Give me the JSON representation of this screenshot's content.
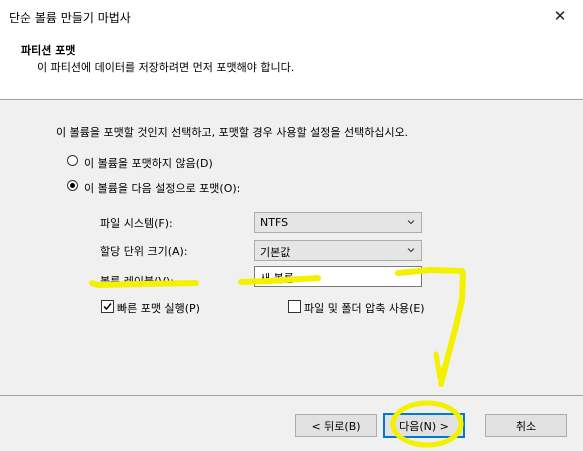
{
  "window": {
    "title": "단순 볼륨 만들기 마법사",
    "close_glyph": "✕"
  },
  "header": {
    "title": "파티션 포맷",
    "subtitle": "이 파티션에 데이터를 저장하려면 먼저 포맷해야 합니다."
  },
  "main": {
    "question": "이 볼륨을 포맷할 것인지 선택하고, 포맷할 경우 사용할 설정을 선택하십시오.",
    "radio_no_format": {
      "label": "이 볼륨을 포맷하지 않음(D)",
      "checked": false
    },
    "radio_format": {
      "label": "이 볼륨을 다음 설정으로 포맷(O):",
      "checked": true
    },
    "file_system": {
      "label": "파일 시스템(F):",
      "value": "NTFS"
    },
    "allocation_unit": {
      "label": "할당 단위 크기(A):",
      "value": "기본값"
    },
    "volume_label": {
      "label": "볼륨 레이블(V):",
      "value": "새 볼륨"
    },
    "quick_format": {
      "label": "빠른 포맷 실행(P)",
      "checked": true
    },
    "compression": {
      "label": "파일 및 폴더 압축 사용(E)",
      "checked": false
    }
  },
  "footer": {
    "back": "< 뒤로(B)",
    "next": "다음(N) >",
    "cancel": "취소"
  },
  "colors": {
    "highlight": "#f3f000",
    "default_button_border": "#0078d7",
    "panel": "#f0f0f0"
  }
}
